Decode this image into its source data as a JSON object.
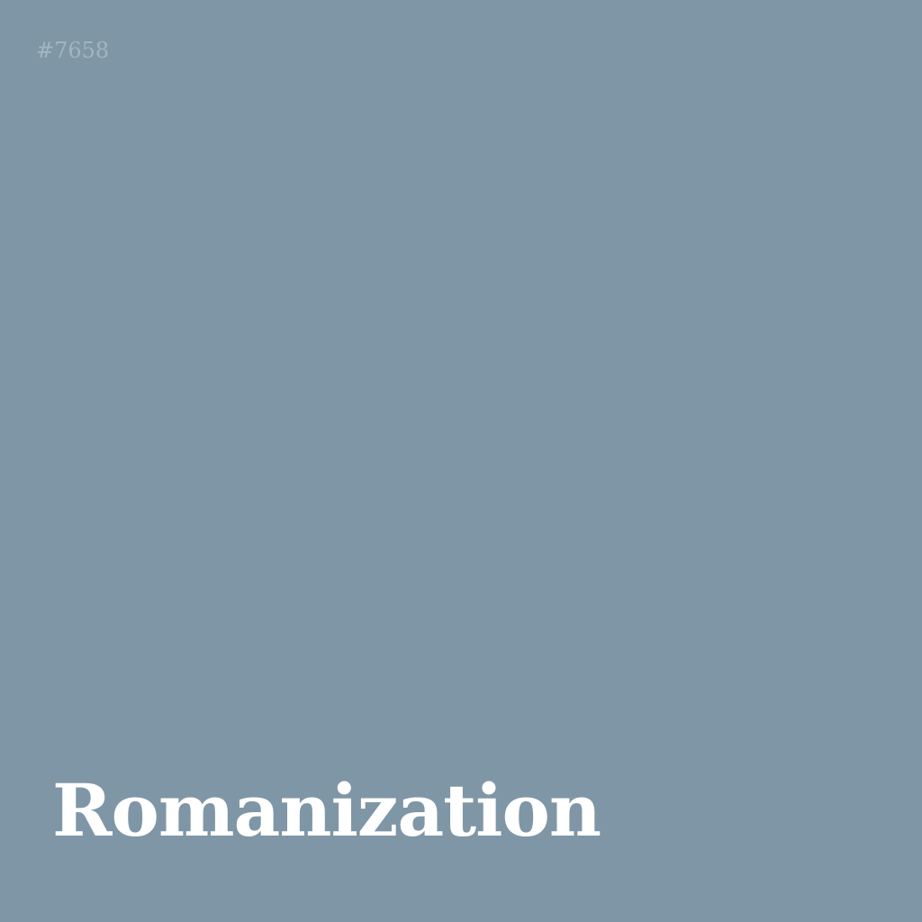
{
  "card": {
    "number": "#7658",
    "title": "Romanization"
  },
  "colors": {
    "background": "#7f96a6",
    "number_text": "#a6b8c5",
    "title_text": "#ffffff"
  }
}
